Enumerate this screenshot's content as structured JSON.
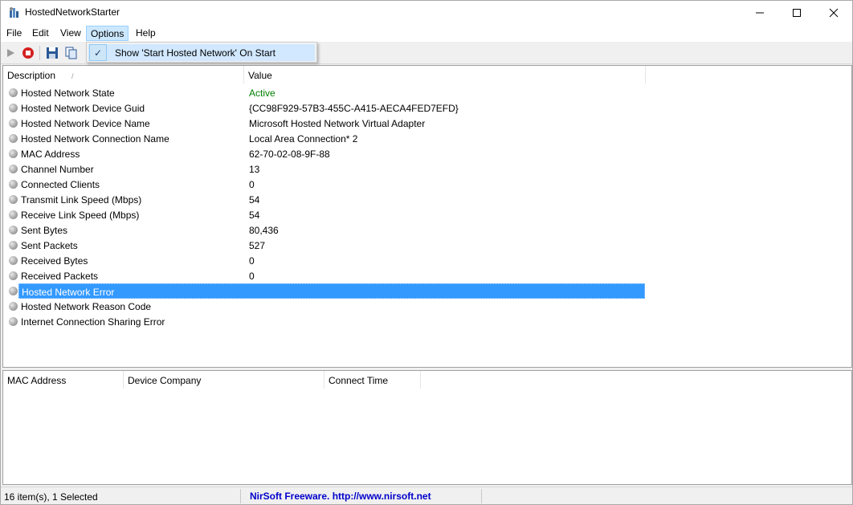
{
  "window": {
    "title": "HostedNetworkStarter"
  },
  "menu": {
    "items": [
      "File",
      "Edit",
      "View",
      "Options",
      "Help"
    ],
    "active": "Options"
  },
  "dropdown": {
    "item_label": "Show 'Start Hosted Network' On Start",
    "checked": true
  },
  "upper_table": {
    "columns": [
      "Description",
      "Value"
    ],
    "rows": [
      {
        "description": "Hosted Network State",
        "value": "Active"
      },
      {
        "description": "Hosted Network Device Guid",
        "value": "{CC98F929-57B3-455C-A415-AECA4FED7EFD}"
      },
      {
        "description": "Hosted Network Device Name",
        "value": "Microsoft Hosted Network Virtual Adapter"
      },
      {
        "description": "Hosted Network Connection Name",
        "value": "Local Area Connection* 2"
      },
      {
        "description": "MAC Address",
        "value": "62-70-02-08-9F-88"
      },
      {
        "description": "Channel Number",
        "value": "13"
      },
      {
        "description": "Connected Clients",
        "value": "0"
      },
      {
        "description": "Transmit Link Speed (Mbps)",
        "value": "54"
      },
      {
        "description": "Receive Link Speed (Mbps)",
        "value": "54"
      },
      {
        "description": "Sent Bytes",
        "value": "80,436"
      },
      {
        "description": "Sent Packets",
        "value": "527"
      },
      {
        "description": "Received Bytes",
        "value": "0"
      },
      {
        "description": "Received Packets",
        "value": "0"
      },
      {
        "description": "Hosted Network Error",
        "value": ""
      },
      {
        "description": "Hosted Network Reason Code",
        "value": ""
      },
      {
        "description": "Internet Connection Sharing Error",
        "value": ""
      }
    ],
    "selected_index": 13
  },
  "lower_table": {
    "columns": [
      "MAC Address",
      "Device Company",
      "Connect Time"
    ]
  },
  "statusbar": {
    "count_text": "16 item(s), 1 Selected",
    "link_text": "NirSoft Freeware.  http://www.nirsoft.net"
  },
  "colors": {
    "active_value": "#008000",
    "selection": "#3399ff",
    "link": "#0000cc"
  }
}
